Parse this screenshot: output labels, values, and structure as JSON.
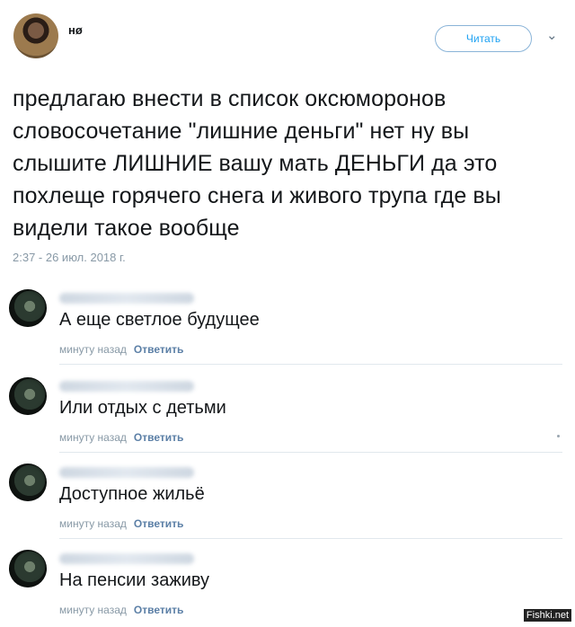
{
  "tweet": {
    "handle": "нø",
    "follow_label": "Читать",
    "chevron": "⌄",
    "text": "предлагаю внести в список оксюморонов словосочетание \"лишние деньги\" нет ну вы слышите ЛИШНИЕ вашу мать ДЕНЬГИ да это похлеще горячего снега и живого трупа где вы видели такое вообще",
    "timestamp": "2:37 - 26 июл. 2018 г."
  },
  "comments": [
    {
      "text": "А еще светлое будущее",
      "time": "минуту назад",
      "reply_label": "Ответить"
    },
    {
      "text": "Или отдых с детьми",
      "time": "минуту назад",
      "reply_label": "Ответить"
    },
    {
      "text": "Доступное жильё",
      "time": "минуту назад",
      "reply_label": "Ответить"
    },
    {
      "text": "На пенсии заживу",
      "time": "минуту назад",
      "reply_label": "Ответить"
    }
  ],
  "watermark": "Fishki.net"
}
